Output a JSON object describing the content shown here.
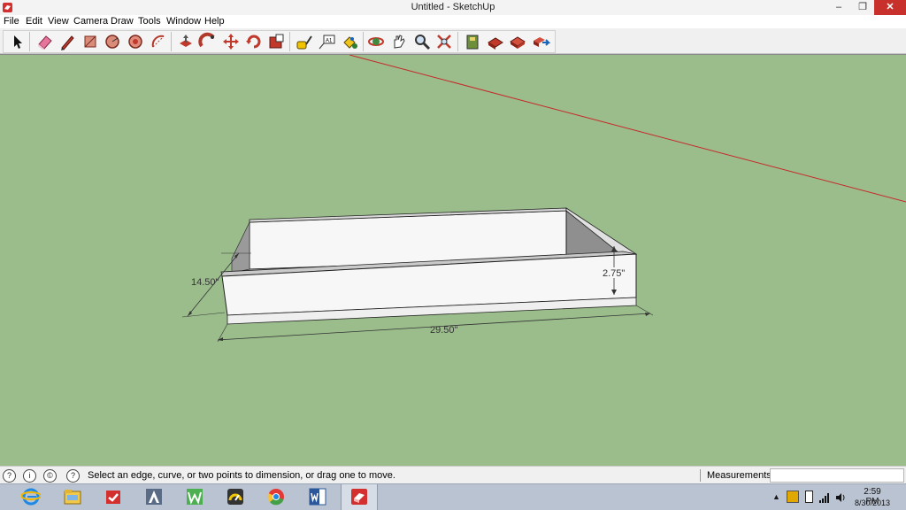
{
  "window": {
    "title": "Untitled - SketchUp",
    "minimize": "–",
    "maximize": "❐",
    "close": "✕"
  },
  "menu": [
    "File",
    "Edit",
    "View",
    "Camera",
    "Draw",
    "Tools",
    "Window",
    "Help"
  ],
  "toolbar": {
    "tools": [
      "select-icon",
      "eraser-icon",
      "pencil-icon",
      "rectangle-icon",
      "circle-icon",
      "polygon-icon",
      "arc-icon",
      "push-pull-icon",
      "follow-me-icon",
      "move-icon",
      "rotate-icon",
      "scale-icon",
      "tape-measure-icon",
      "text-icon",
      "paint-bucket-icon",
      "orbit-icon",
      "pan-icon",
      "zoom-icon",
      "zoom-extents-icon",
      "components-icon",
      "3d-warehouse-icon",
      "share-model-icon",
      "upload-icon"
    ]
  },
  "model": {
    "dimensions": {
      "length": "29.50\"",
      "width": "14.50\"",
      "height": "2.75\""
    },
    "colors": {
      "background": "#9bbd8c",
      "red_axis": "#c62828",
      "face": "#f7f7f7",
      "inner_wall": "#8f8f8f",
      "floor": "#a9a9a9"
    }
  },
  "status": {
    "hint": "Select an edge, curve, or two points to dimension, or drag one to move.",
    "measurements_label": "Measurements",
    "measurements_value": ""
  },
  "taskbar": {
    "apps": [
      "internet-explorer-icon",
      "file-explorer-icon",
      "app-store-icon",
      "adobe-reader-icon",
      "word-perfect-icon",
      "speed-dial-icon",
      "chrome-icon",
      "word-icon",
      "sketchup-icon"
    ],
    "active_app": "sketchup-icon",
    "clock_time": "2:59 PM",
    "clock_date": "8/30/2013"
  }
}
